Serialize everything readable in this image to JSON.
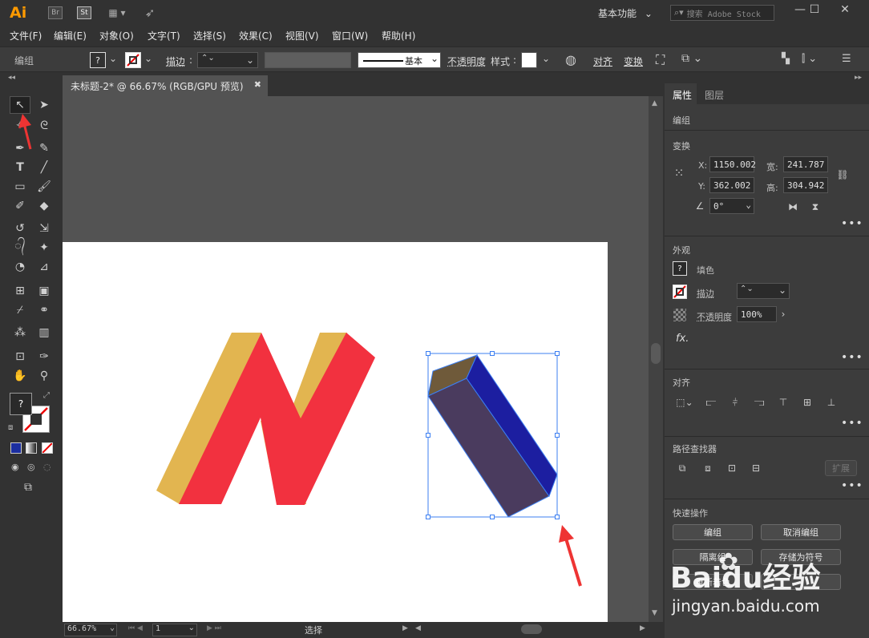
{
  "app": {
    "logo": "Ai",
    "bridge": "Br",
    "stock": "St",
    "workspace": "基本功能",
    "search_placeholder": "搜索 Adobe Stock"
  },
  "menu": [
    "文件(F)",
    "编辑(E)",
    "对象(O)",
    "文字(T)",
    "选择(S)",
    "效果(C)",
    "视图(V)",
    "窗口(W)",
    "帮助(H)"
  ],
  "control": {
    "group_label": "编组",
    "stroke_label": "描边",
    "stroke_style": "基本",
    "opacity_label": "不透明度",
    "style_label": "样式",
    "align_label": "对齐",
    "transform_label": "变换"
  },
  "document": {
    "tab_title": "未标题-2* @ 66.67% (RGB/GPU 预览)",
    "zoom": "66.67%",
    "page": "1",
    "status_tool": "选择"
  },
  "panel": {
    "tab_properties": "属性",
    "tab_layers": "图层",
    "object_type": "编组",
    "transform_title": "变换",
    "x_label": "X:",
    "x_value": "1150.002",
    "y_label": "Y:",
    "y_value": "362.002",
    "w_label": "宽:",
    "w_value": "241.787",
    "h_label": "高:",
    "h_value": "304.942",
    "angle_value": "0°",
    "appearance_title": "外观",
    "fill_label": "填色",
    "stroke_label": "描边",
    "opacity_label": "不透明度",
    "opacity_value": "100%",
    "fx_label": "fx.",
    "align_title": "对齐",
    "pathfinder_title": "路径查找器",
    "expand_label": "扩展",
    "quick_title": "快速操作",
    "btn_group": "编组",
    "btn_ungroup": "取消编组",
    "btn_isolate": "隔离组",
    "btn_save_symbol": "存储为符号",
    "btn_recolor": "重新着色"
  },
  "colors": {
    "logo_orange": "#ff9a00",
    "shape_gold": "#e2b550",
    "shape_red": "#f2313f",
    "prism_front": "#4a3b5e",
    "prism_side": "#1c1ea0",
    "prism_top": "#6f5a3a",
    "selection": "#3c7ff2",
    "arrow_red": "#ee3433"
  },
  "watermark": {
    "brand": "Baidu经验",
    "url": "jingyan.baidu.com"
  }
}
